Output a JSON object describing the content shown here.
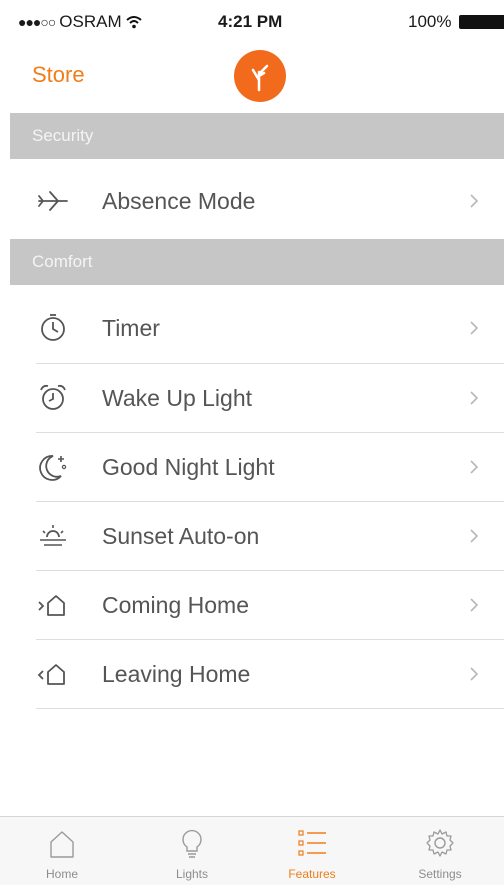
{
  "status_bar": {
    "signal": "●●●○○",
    "carrier": "OSRAM",
    "time": "4:21 PM",
    "battery": "100%"
  },
  "nav": {
    "store_label": "Store"
  },
  "sections": {
    "security": {
      "title": "Security",
      "items": [
        {
          "label": "Absence Mode",
          "icon": "airplane-icon"
        }
      ]
    },
    "comfort": {
      "title": "Comfort",
      "items": [
        {
          "label": "Timer",
          "icon": "clock-icon"
        },
        {
          "label": "Wake Up Light",
          "icon": "alarm-clock-icon"
        },
        {
          "label": "Good Night Light",
          "icon": "moon-star-icon"
        },
        {
          "label": "Sunset Auto-on",
          "icon": "sunset-icon"
        },
        {
          "label": "Coming Home",
          "icon": "coming-home-icon"
        },
        {
          "label": "Leaving Home",
          "icon": "leaving-home-icon"
        }
      ]
    }
  },
  "tabs": [
    {
      "label": "Home",
      "icon": "home-icon",
      "active": false
    },
    {
      "label": "Lights",
      "icon": "light-bulb-icon",
      "active": false
    },
    {
      "label": "Features",
      "icon": "features-list-icon",
      "active": true
    },
    {
      "label": "Settings",
      "icon": "gear-icon",
      "active": false
    }
  ],
  "colors": {
    "accent": "#f07d1a",
    "logo": "#f26b1d",
    "section_header": "#c6c6c6",
    "tab_bar": "#f7f7f7"
  }
}
